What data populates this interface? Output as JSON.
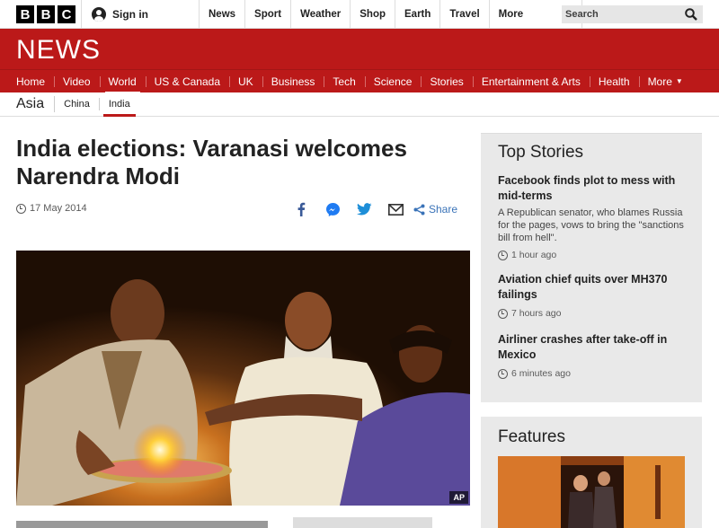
{
  "masthead": {
    "logo_letters": [
      "B",
      "B",
      "C"
    ],
    "signin_label": "Sign in",
    "nav_items": [
      "News",
      "Sport",
      "Weather",
      "Shop",
      "Earth",
      "Travel"
    ],
    "more_label": "More",
    "search_placeholder": "Search"
  },
  "banner": {
    "title": "NEWS"
  },
  "news_nav": {
    "items": [
      "Home",
      "Video",
      "World",
      "US & Canada",
      "UK",
      "Business",
      "Tech",
      "Science",
      "Stories",
      "Entertainment & Arts",
      "Health"
    ],
    "active": "World",
    "more_label": "More"
  },
  "sub_nav": {
    "section": "Asia",
    "items": [
      "China",
      "India"
    ],
    "active": "India"
  },
  "article": {
    "headline": "India elections: Varanasi welcomes Narendra Modi",
    "date": "17 May 2014",
    "share_label": "Share",
    "image_credit": "AP"
  },
  "top_stories": {
    "title": "Top Stories",
    "items": [
      {
        "title": "Facebook finds plot to mess with mid-terms",
        "summary": "A Republican senator, who blames Russia for the pages, vows to bring the \"sanctions bill from hell\".",
        "time": "1 hour ago"
      },
      {
        "title": "Aviation chief quits over MH370 failings",
        "summary": "",
        "time": "7 hours ago"
      },
      {
        "title": "Airliner crashes after take-off in Mexico",
        "summary": "",
        "time": "6 minutes ago"
      }
    ]
  },
  "features": {
    "title": "Features"
  },
  "colors": {
    "brand_red": "#bb1919",
    "share_blue": "#3a73b8"
  }
}
